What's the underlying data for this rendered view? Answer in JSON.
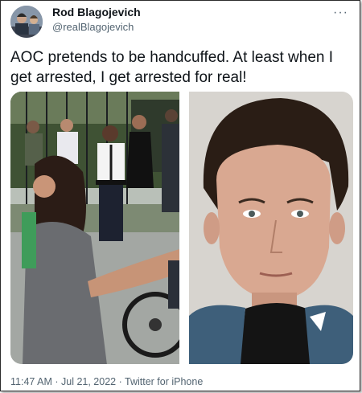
{
  "user": {
    "display_name": "Rod Blagojevich",
    "handle": "@realBlagojevich"
  },
  "tweet": {
    "text": "AOC pretends to be handcuffed. At least when I get arrested, I get arrested for real!"
  },
  "meta": {
    "time": "11:47 AM",
    "separator": " · ",
    "date": "Jul 21, 2022",
    "source": "Twitter for iPhone"
  },
  "icons": {
    "more": "more-options-icon"
  },
  "colors": {
    "text": "#0f1419",
    "secondary": "#536471"
  }
}
